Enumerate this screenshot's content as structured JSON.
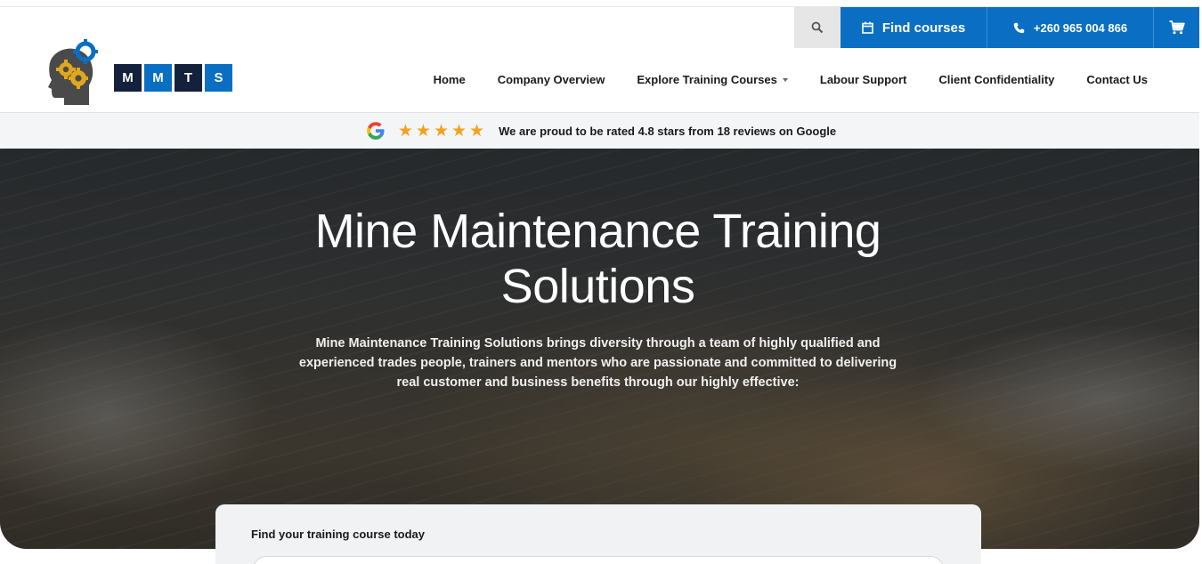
{
  "header": {
    "logo_letters": [
      "M",
      "M",
      "T",
      "S"
    ],
    "search_icon": "search-icon",
    "find_courses_label": "Find courses",
    "phone": "+260 965 004 866",
    "cart_icon": "cart-icon"
  },
  "nav": {
    "items": [
      {
        "label": "Home"
      },
      {
        "label": "Company Overview"
      },
      {
        "label": "Explore Training Courses",
        "has_dropdown": true
      },
      {
        "label": "Labour Support"
      },
      {
        "label": "Client Confidentiality"
      },
      {
        "label": "Contact Us"
      }
    ]
  },
  "rating": {
    "stars": 5,
    "text": "We are proud to be rated 4.8 stars from 18 reviews on Google"
  },
  "hero": {
    "title_line1": "Mine Maintenance Training",
    "title_line2": "Solutions",
    "desc_line1": "Mine Maintenance Training Solutions brings diversity through a team of highly qualified and",
    "desc_line2": "experienced trades people, trainers and mentors who are passionate and committed to delivering",
    "desc_line3": "real customer and business benefits through our highly effective:"
  },
  "search_card": {
    "label": "Find your training course today"
  },
  "colors": {
    "brand_blue": "#0a6fc2",
    "brand_dark": "#14213d",
    "star": "#f4a21e"
  }
}
